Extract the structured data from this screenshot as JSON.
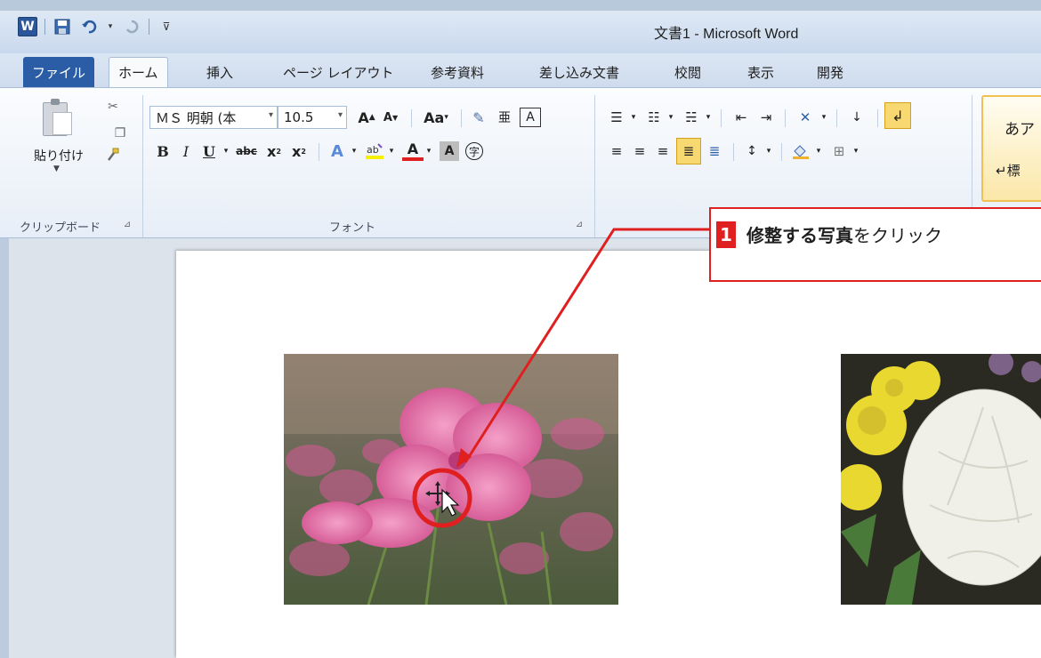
{
  "window": {
    "title": "文書1 - Microsoft Word",
    "app_icon": "W"
  },
  "quick_access": {
    "icons": [
      "word-app-icon",
      "save-icon",
      "undo-icon",
      "redo-icon",
      "customize-icon"
    ]
  },
  "tabs": [
    {
      "label": "ファイル",
      "kind": "file"
    },
    {
      "label": "ホーム",
      "kind": "active"
    },
    {
      "label": "挿入",
      "kind": "normal"
    },
    {
      "label": "ページ レイアウト",
      "kind": "normal"
    },
    {
      "label": "参考資料",
      "kind": "normal"
    },
    {
      "label": "差し込み文書",
      "kind": "normal"
    },
    {
      "label": "校閲",
      "kind": "normal"
    },
    {
      "label": "表示",
      "kind": "normal"
    },
    {
      "label": "開発",
      "kind": "normal"
    }
  ],
  "ribbon": {
    "clipboard": {
      "paste_label": "貼り付け",
      "group_label": "クリップボード"
    },
    "font": {
      "font_name": "ＭＳ 明朝 (本",
      "font_size": "10.5",
      "group_label": "フォント",
      "grow": "A",
      "shrink": "A",
      "case": "Aa",
      "bold": "B",
      "italic": "I",
      "underline": "U",
      "strike": "abc",
      "subscript": "x",
      "superscript": "x",
      "font_color": "A",
      "char_shading": "A",
      "enclose": "字"
    },
    "styles": {
      "sample1": "あア",
      "sample2": "↵標"
    }
  },
  "callout": {
    "number": "1",
    "text_bold": "修整する写真",
    "text_rest": "をクリック"
  },
  "colors": {
    "accent_red": "#e02020",
    "file_tab": "#2a5da6"
  }
}
